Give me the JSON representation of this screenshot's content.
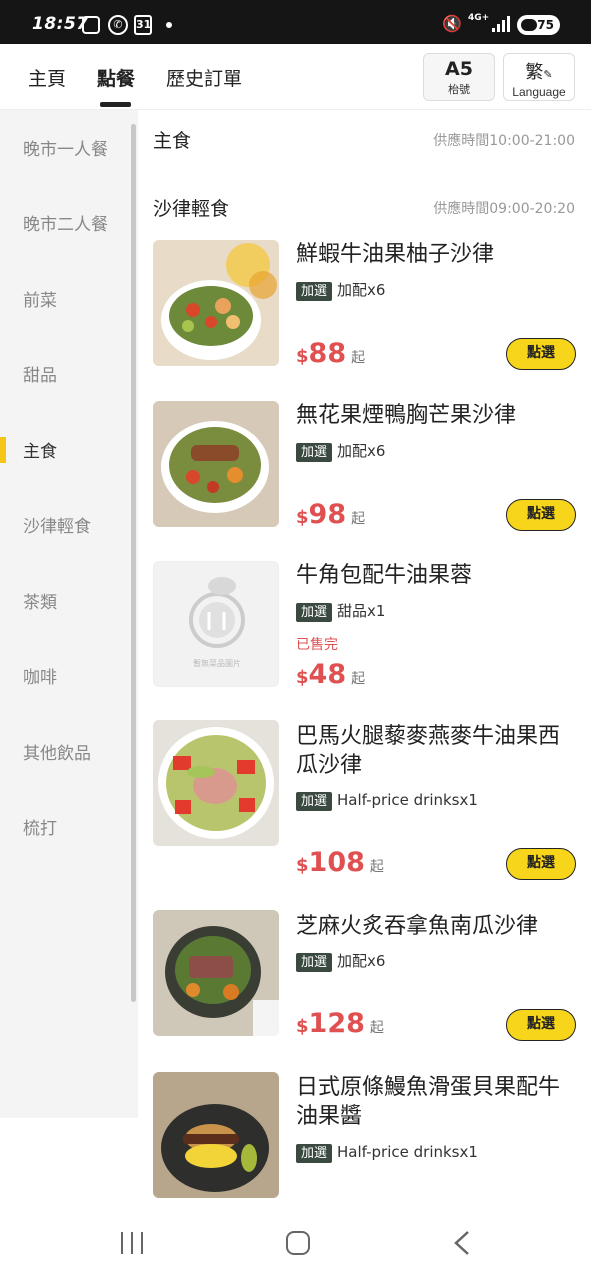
{
  "status_bar": {
    "time": "18:57",
    "calendar_day": "31",
    "network": "4G+",
    "battery": "75"
  },
  "header": {
    "tabs": [
      {
        "label": "主頁"
      },
      {
        "label": "點餐"
      },
      {
        "label": "歷史訂單"
      }
    ],
    "active_tab": "點餐",
    "table": {
      "number": "A5",
      "label": "枱號"
    },
    "language": {
      "char": "繁",
      "label": "Language"
    }
  },
  "sidebar": {
    "items": [
      {
        "label": "晚市一人餐"
      },
      {
        "label": "晚市二人餐"
      },
      {
        "label": "前菜"
      },
      {
        "label": "甜品"
      },
      {
        "label": "主食"
      },
      {
        "label": "沙律輕食"
      },
      {
        "label": "茶類"
      },
      {
        "label": "咖啡"
      },
      {
        "label": "其他飲品"
      },
      {
        "label": "梳打"
      }
    ],
    "active": "主食"
  },
  "sections": [
    {
      "title": "主食",
      "time": "供應時間10:00-21:00"
    },
    {
      "title": "沙律輕食",
      "time": "供應時間09:00-20:20"
    }
  ],
  "items": [
    {
      "name": "鮮蝦牛油果柚子沙律",
      "tag_badge": "加選",
      "tag_text": "加配x6",
      "currency": "$",
      "price": "88",
      "from": "起",
      "button": "點選"
    },
    {
      "name": "無花果煙鴨胸芒果沙律",
      "tag_badge": "加選",
      "tag_text": "加配x6",
      "currency": "$",
      "price": "98",
      "from": "起",
      "button": "點選"
    },
    {
      "name": "牛角包配牛油果蓉",
      "tag_badge": "加選",
      "tag_text": "甜品x1",
      "soldout": "已售完",
      "currency": "$",
      "price": "48",
      "from": "起",
      "placeholder_text": "暫無菜品圖片"
    },
    {
      "name": "巴馬火腿藜麥燕麥牛油果西瓜沙律",
      "tag_badge": "加選",
      "tag_text": "Half-price drinksx1",
      "currency": "$",
      "price": "108",
      "from": "起",
      "button": "點選"
    },
    {
      "name": "芝麻火炙吞拿魚南瓜沙律",
      "tag_badge": "加選",
      "tag_text": "加配x6",
      "currency": "$",
      "price": "128",
      "from": "起",
      "button": "點選"
    },
    {
      "name": "日式原條鰻魚滑蛋貝果配牛油果醬",
      "tag_badge": "加選",
      "tag_text": "Half-price drinksx1"
    }
  ],
  "colors": {
    "accent_yellow": "#f7d51a",
    "price_red": "#e05050",
    "badge_green": "#3a4a40",
    "sidebar_bg": "#f4f4f4"
  }
}
